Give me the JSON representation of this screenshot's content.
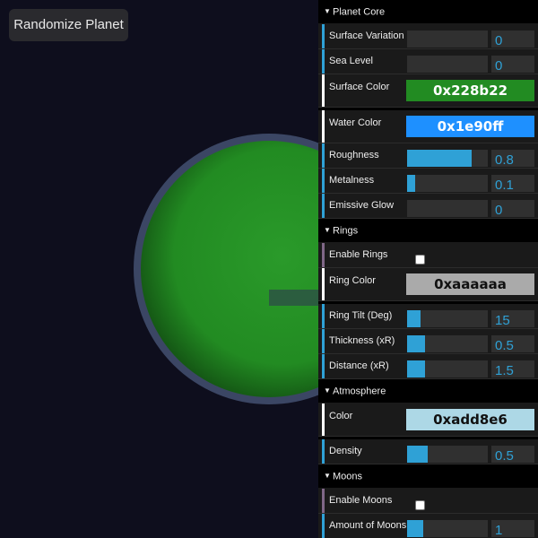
{
  "toolbar": {
    "randomize_label": "Randomize Planet"
  },
  "colors": {
    "background": "#0e0e1d",
    "planet_surface": "#228b22",
    "atmosphere": "#add8e6",
    "ring": "#aaaaaa",
    "slider_fill": "#2fa1d6",
    "number_bar": "#2fa1d6",
    "color_bar": "#e61d5f",
    "boolean_bar": "#806787"
  },
  "gui": {
    "planet_core": {
      "title": "Planet Core",
      "surface_variation": {
        "label": "Surface Variation",
        "value": "0",
        "fraction": 0
      },
      "sea_level": {
        "label": "Sea Level",
        "value": "0",
        "fraction": 0
      },
      "surface_color": {
        "label": "Surface Color",
        "value": "0x228b22",
        "color": "#228b22"
      },
      "water_color": {
        "label": "Water Color",
        "value": "0x1e90ff",
        "color": "#1e90ff"
      },
      "roughness": {
        "label": "Roughness",
        "value": "0.8",
        "fraction": 0.8
      },
      "metalness": {
        "label": "Metalness",
        "value": "0.1",
        "fraction": 0.1
      },
      "emissive_glow": {
        "label": "Emissive Glow",
        "value": "0",
        "fraction": 0
      }
    },
    "rings": {
      "title": "Rings",
      "enable_rings": {
        "label": "Enable Rings",
        "checked": false
      },
      "ring_color": {
        "label": "Ring Color",
        "value": "0xaaaaaa",
        "color": "#aaaaaa"
      },
      "ring_tilt": {
        "label": "Ring Tilt (Deg)",
        "value": "15",
        "fraction": 0.17
      },
      "thickness": {
        "label": "Thickness (xR)",
        "value": "0.5",
        "fraction": 0.22
      },
      "distance": {
        "label": "Distance (xR)",
        "value": "1.5",
        "fraction": 0.22
      }
    },
    "atmosphere": {
      "title": "Atmosphere",
      "color": {
        "label": "Color",
        "value": "0xadd8e6",
        "color": "#add8e6"
      },
      "density": {
        "label": "Density",
        "value": "0.5",
        "fraction": 0.25
      }
    },
    "moons": {
      "title": "Moons",
      "enable_moons": {
        "label": "Enable Moons",
        "checked": false
      },
      "amount": {
        "label": "Amount of Moons",
        "value": "1",
        "fraction": 0.2
      }
    }
  }
}
